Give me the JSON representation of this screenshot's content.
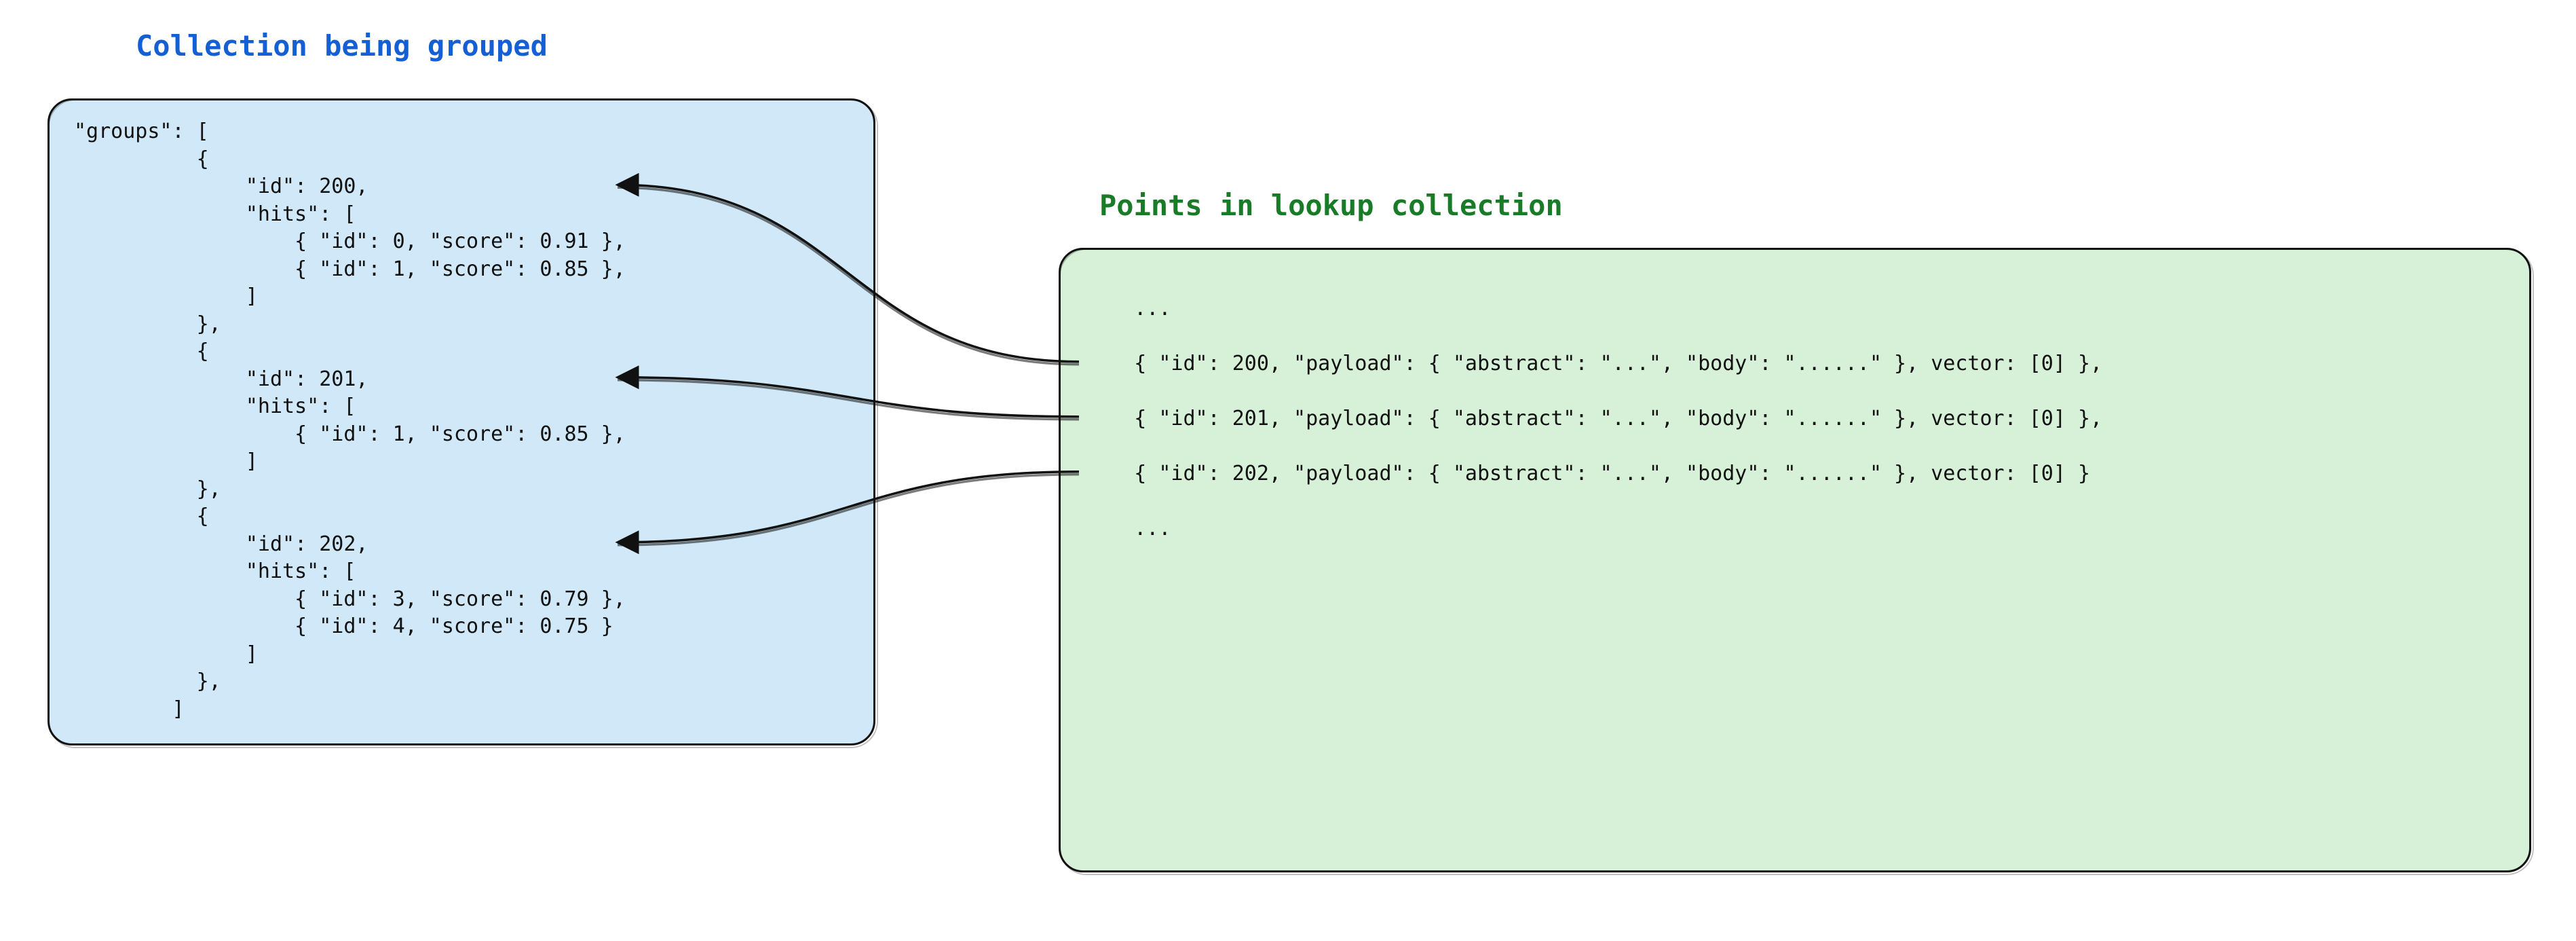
{
  "titles": {
    "left": "Collection being grouped",
    "right": "Points in lookup collection"
  },
  "left_panel": {
    "key_label": "groups",
    "groups": [
      {
        "id": 200,
        "hits": [
          {
            "id": 0,
            "score": 0.91
          },
          {
            "id": 1,
            "score": 0.85
          }
        ],
        "trailing_comma_on_close": true
      },
      {
        "id": 201,
        "hits": [
          {
            "id": 1,
            "score": 0.85
          }
        ],
        "trailing_comma_on_close": true
      },
      {
        "id": 202,
        "hits": [
          {
            "id": 3,
            "score": 0.79
          },
          {
            "id": 4,
            "score": 0.75
          }
        ],
        "trailing_comma_on_close": false
      }
    ]
  },
  "right_panel": {
    "ellipsis_leading": "...",
    "ellipsis_trailing": "...",
    "points": [
      {
        "id": 200,
        "payload": {
          "abstract": "...",
          "body": "......"
        },
        "vector_literal": "[0]",
        "trailing_comma": true
      },
      {
        "id": 201,
        "payload": {
          "abstract": "...",
          "body": "......"
        },
        "vector_literal": "[0]",
        "trailing_comma": true
      },
      {
        "id": 202,
        "payload": {
          "abstract": "...",
          "body": "......"
        },
        "vector_literal": "[0]",
        "trailing_comma": false
      }
    ]
  },
  "colors": {
    "panel_blue_bg": "#d0e8f7",
    "panel_green_bg": "#d6f1d8",
    "title_blue": "#145fd3",
    "title_green": "#197b27",
    "stroke": "#111111"
  },
  "arrow_links": [
    {
      "from_point_id": 200,
      "to_group_id": 200
    },
    {
      "from_point_id": 201,
      "to_group_id": 201
    },
    {
      "from_point_id": 202,
      "to_group_id": 202
    }
  ]
}
